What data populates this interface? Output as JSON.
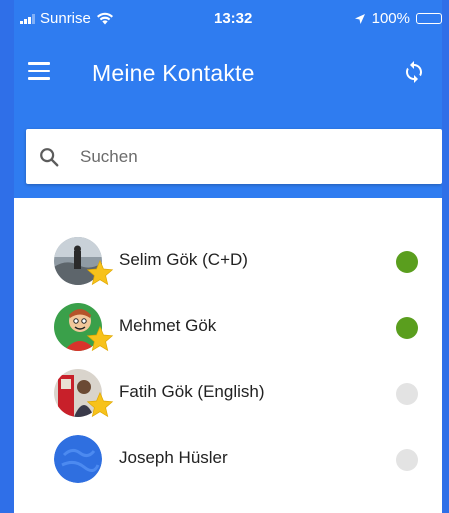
{
  "statusbar": {
    "carrier": "Sunrise",
    "time": "13:32",
    "battery": "100%"
  },
  "appbar": {
    "title": "Meine Kontakte",
    "menu_icon": "hamburger-menu-icon",
    "sync_icon": "sync-icon"
  },
  "search": {
    "placeholder": "Suchen",
    "value": ""
  },
  "colors": {
    "primary": "#2f7cf0",
    "online": "#5a9e1e",
    "offline": "#e3e3e3",
    "favorite_star": "#f7c21b"
  },
  "contacts": [
    {
      "name": "Selim Gök (C+D)",
      "favorite": true,
      "status": "online"
    },
    {
      "name": "Mehmet Gök",
      "favorite": true,
      "status": "online"
    },
    {
      "name": "Fatih Gök (English)",
      "favorite": true,
      "status": "offline"
    },
    {
      "name": "Joseph Hüsler",
      "favorite": false,
      "status": "offline"
    }
  ]
}
